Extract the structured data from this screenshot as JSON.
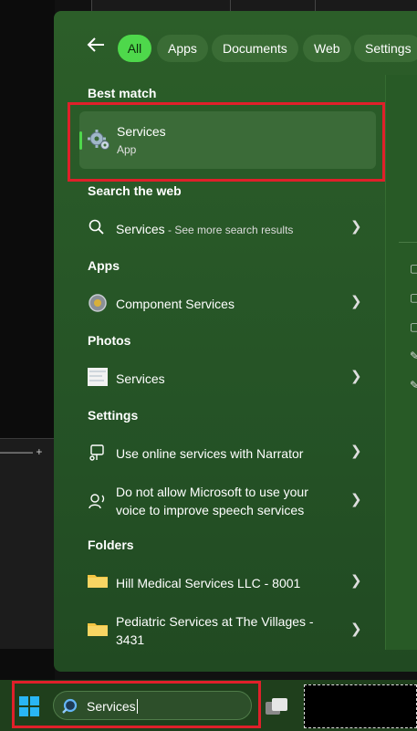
{
  "filters": {
    "tabs": [
      {
        "label": "All",
        "active": true
      },
      {
        "label": "Apps",
        "active": false
      },
      {
        "label": "Documents",
        "active": false
      },
      {
        "label": "Web",
        "active": false
      },
      {
        "label": "Settings",
        "active": false
      }
    ]
  },
  "best_match": {
    "heading": "Best match",
    "title": "Services",
    "subtitle": "App"
  },
  "web": {
    "heading": "Search the web",
    "query": "Services",
    "suffix": " - See more search results"
  },
  "apps": {
    "heading": "Apps",
    "items": [
      {
        "label": "Component Services"
      }
    ]
  },
  "photos": {
    "heading": "Photos",
    "items": [
      {
        "label": "Services"
      }
    ]
  },
  "settings": {
    "heading": "Settings",
    "items": [
      {
        "label": "Use online services with Narrator"
      },
      {
        "line1": "Do not allow Microsoft to use your",
        "line2": "voice to improve speech services"
      }
    ]
  },
  "folders": {
    "heading": "Folders",
    "items": [
      {
        "label": "Hill Medical Services LLC - 8001"
      },
      {
        "line1": "Pediatric Services at The Villages -",
        "line2": "3431"
      }
    ]
  },
  "taskbar": {
    "search_value": "Services"
  },
  "colors": {
    "panel": "#2c5e29",
    "accent": "#4ed84b",
    "highlight_box": "#e0202a",
    "taskbar": "#1f3f1c"
  },
  "icons": [
    "back-arrow-icon",
    "gear-icon",
    "search-icon",
    "chevron-right-icon",
    "component-services-icon",
    "photo-thumbnail-icon",
    "narrator-icon",
    "speech-icon",
    "folder-icon",
    "windows-logo-icon",
    "task-view-icon"
  ]
}
